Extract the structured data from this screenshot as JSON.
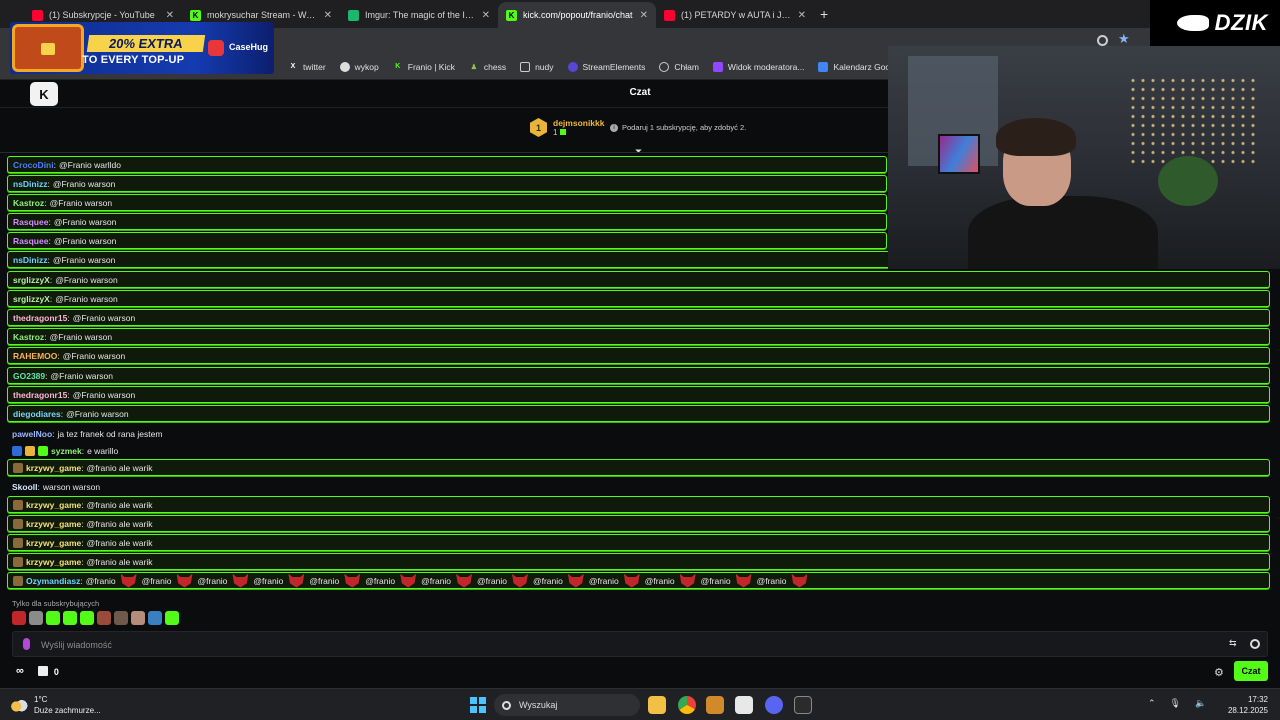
{
  "browser": {
    "tabs": [
      {
        "title": "(1) Subskrypcje - YouTube",
        "icon": "youtube-icon",
        "color": "#ff0033",
        "active": false
      },
      {
        "title": "mokrysuchar Stream - Watch Li",
        "icon": "kick-icon",
        "color": "#53fc18",
        "active": false
      },
      {
        "title": "Imgur: The magic of the Interne",
        "icon": "imgur-icon",
        "color": "#1bb76e",
        "active": false
      },
      {
        "title": "kick.com/popout/franio/chat",
        "icon": "kick-icon",
        "color": "#53fc18",
        "active": true
      },
      {
        "title": "(1) PETARDY w AUTA i Jedzenie",
        "icon": "youtube-icon",
        "color": "#ff0033",
        "active": false
      }
    ],
    "new_tab": "+",
    "close_glyph": "✕",
    "bookmarks": [
      {
        "label": "twitter",
        "icon": "x-icon"
      },
      {
        "label": "wykop",
        "icon": "wykop-icon"
      },
      {
        "label": "Franio | Kick",
        "icon": "kick-icon"
      },
      {
        "label": "chess",
        "icon": "chess-icon"
      },
      {
        "label": "nudy",
        "icon": "folder-icon"
      },
      {
        "label": "StreamElements",
        "icon": "streamelements-icon"
      },
      {
        "label": "Chłam",
        "icon": "globe-icon"
      },
      {
        "label": "Widok moderatora...",
        "icon": "twitch-icon"
      },
      {
        "label": "Kalendarz Google -...",
        "icon": "calendar-icon"
      }
    ]
  },
  "ad": {
    "headline": "20% EXTRA",
    "subline": "TO EVERY TOP-UP",
    "brand": "CaseHug"
  },
  "overlay": {
    "logo_text": "DZIK"
  },
  "chat": {
    "title": "Czat",
    "leaderboard": {
      "rank": "1",
      "username": "dejmsonikkk",
      "count": "1",
      "rank_color": "#e8b53a"
    },
    "gift_prompt": "Podaruj 1 subskrypcję, aby zdobyć 2.",
    "messages": [
      {
        "user": "CrocoDini",
        "color": "#4f7bff",
        "text": "@Franio warlldo",
        "highlight": true
      },
      {
        "user": "nsDinizz",
        "color": "#6fd3ff",
        "text": "@Franio warson",
        "highlight": true
      },
      {
        "user": "Kastroz",
        "color": "#8ef27a",
        "text": "@Franio warson",
        "highlight": true
      },
      {
        "user": "Rasquee",
        "color": "#d58cff",
        "text": "@Franio warson",
        "highlight": true
      },
      {
        "user": "Rasquee",
        "color": "#d58cff",
        "text": "@Franio warson",
        "highlight": true
      },
      {
        "user": "nsDinizz",
        "color": "#6fd3ff",
        "text": "@Franio warson",
        "highlight": true
      },
      {
        "user": "srglizzyX",
        "color": "#b6f0a1",
        "text": "@Franio warson",
        "highlight": true
      },
      {
        "user": "srglizzyX",
        "color": "#b6f0a1",
        "text": "@Franio warson",
        "highlight": true
      },
      {
        "user": "thedragonr15",
        "color": "#ffb3d9",
        "text": "@Franio warson",
        "highlight": true
      },
      {
        "user": "Kastroz",
        "color": "#8ef27a",
        "text": "@Franio warson",
        "highlight": true
      },
      {
        "user": "RAHEMOO",
        "color": "#ffb15c",
        "text": "@Franio warson",
        "highlight": true
      },
      {
        "user": "GO2389",
        "color": "#5ee6a8",
        "text": "@Franio warson",
        "highlight": true
      },
      {
        "user": "thedragonr15",
        "color": "#ffb3d9",
        "text": "@Franio warson",
        "highlight": true
      },
      {
        "user": "diegodiares",
        "color": "#7fd3ff",
        "text": "@Franio warson",
        "highlight": true
      },
      {
        "user": "pawelNoo",
        "color": "#9ab8ff",
        "text": "ja tez franek od rana jestem",
        "highlight": false
      },
      {
        "user": "syzmek",
        "color": "#8ef27a",
        "text": "e warillo",
        "highlight": false,
        "badges": [
          "verified-badge",
          "sub-badge",
          "check-badge"
        ]
      },
      {
        "user": "krzywy_game",
        "color": "#f2e27a",
        "text": "@franio ale warik",
        "highlight": true,
        "badges": [
          "sword-badge"
        ]
      },
      {
        "user": "Skooll",
        "color": "#d7e8ff",
        "text": "warson warson",
        "highlight": false
      },
      {
        "user": "krzywy_game",
        "color": "#f2e27a",
        "text": "@franio ale warik",
        "highlight": true,
        "badges": [
          "sword-badge"
        ]
      },
      {
        "user": "krzywy_game",
        "color": "#f2e27a",
        "text": "@franio ale warik",
        "highlight": true,
        "badges": [
          "sword-badge"
        ]
      },
      {
        "user": "krzywy_game",
        "color": "#f2e27a",
        "text": "@franio ale warik",
        "highlight": true,
        "badges": [
          "sword-badge"
        ]
      },
      {
        "user": "krzywy_game",
        "color": "#f2e27a",
        "text": "@franio ale warik",
        "highlight": true,
        "badges": [
          "sword-badge"
        ]
      },
      {
        "user": "Ozymandiasz",
        "color": "#6fd3ff",
        "text": "@franio",
        "highlight": true,
        "badges": [
          "sword-badge"
        ],
        "repeat_with_emote": 13
      }
    ],
    "subs_only_label": "Tylko dla subskrybujących",
    "input_placeholder": "Wyślij wiadomość",
    "footer": {
      "infinity": "∞",
      "gift_count": "0"
    },
    "send_label": "Czat"
  },
  "taskbar": {
    "weather_temp": "1°C",
    "weather_desc": "Duże zachmurze...",
    "search_label": "Wyszukaj",
    "time": "17:32",
    "date": "28.12.2025"
  }
}
